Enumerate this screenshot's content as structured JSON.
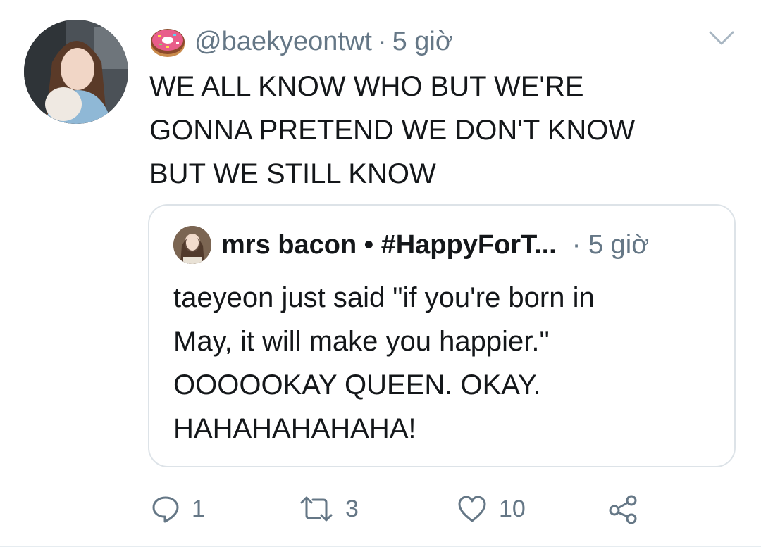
{
  "tweet": {
    "emoji_icon": "donut-icon",
    "handle": "@baekyeontwt",
    "separator": "·",
    "time": "5 giờ",
    "text": "WE ALL KNOW WHO BUT WE'RE\nGONNA PRETEND WE DON'T KNOW\nBUT WE STILL KNOW"
  },
  "quote": {
    "name": "mrs bacon • #HappyForT...",
    "separator": "·",
    "time": "5 giờ",
    "text": "taeyeon just said \"if you're born in\nMay, it will make you happier.\"\nOOOOOKAY QUEEN. OKAY.\nHAHAHAHAHAHA!"
  },
  "actions": {
    "reply_count": "1",
    "retweet_count": "3",
    "like_count": "10"
  },
  "colors": {
    "text_primary": "#14171a",
    "text_secondary": "#657786",
    "border": "#dde3e8"
  }
}
